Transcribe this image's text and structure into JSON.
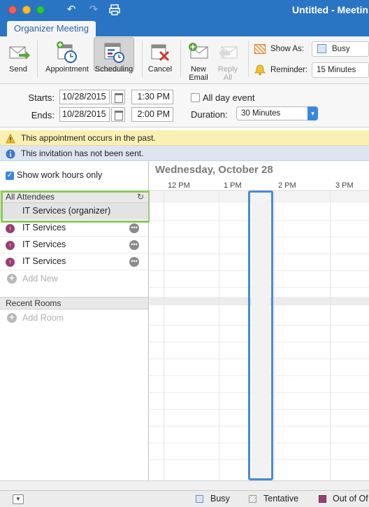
{
  "window": {
    "title": "Untitled - Meetin",
    "active_tab": "Organizer Meeting"
  },
  "ribbon": {
    "send": "Send",
    "appointment": "Appointment",
    "scheduling": "Scheduling",
    "cancel": "Cancel",
    "new_email": "New\nEmail",
    "reply_all": "Reply\nAll",
    "show_as_label": "Show As:",
    "show_as_value": "Busy",
    "reminder_label": "Reminder:",
    "reminder_value": "15 Minutes"
  },
  "times": {
    "starts_label": "Starts:",
    "ends_label": "Ends:",
    "start_date": "10/28/2015",
    "start_time": "1:30 PM",
    "end_date": "10/28/2015",
    "end_time": "2:00 PM",
    "all_day_label": "All day event",
    "duration_label": "Duration:",
    "duration_value": "30 Minutes"
  },
  "info": {
    "warning": "This appointment occurs in the past.",
    "note": "This invitation has not been sent."
  },
  "attendees": {
    "work_hours_label": "Show work hours only",
    "all_header": "All Attendees",
    "organizer": "IT Services (organizer)",
    "list": [
      "IT Services",
      "IT Services",
      "IT Services"
    ],
    "add_new": "Add New",
    "rooms_header": "Recent Rooms",
    "add_room": "Add Room"
  },
  "schedule": {
    "day_title": "Wednesday, October 28",
    "hours": [
      "12 PM",
      "1 PM",
      "2 PM",
      "3 PM"
    ]
  },
  "legend": {
    "busy": "Busy",
    "tentative": "Tentative",
    "out_of_office": "Out of Of",
    "colors": {
      "busy": "#d9e6f5",
      "out_of_office": "#9a3d74"
    }
  }
}
